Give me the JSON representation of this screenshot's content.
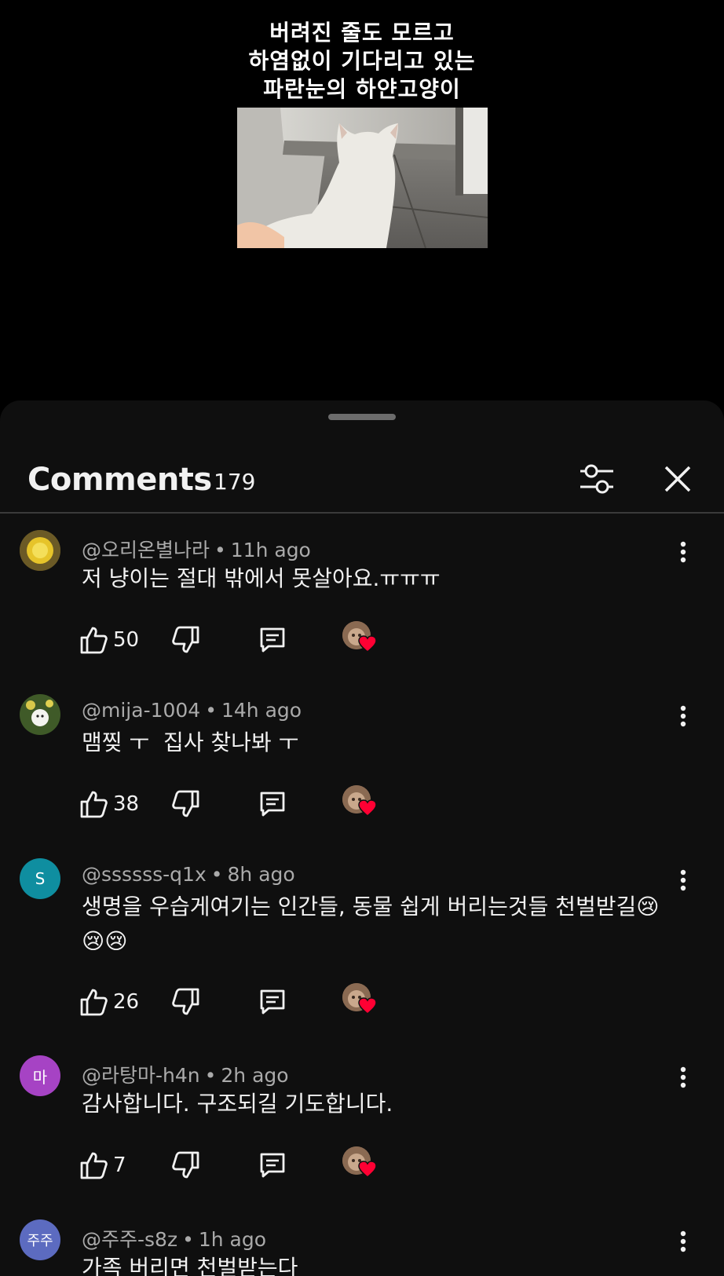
{
  "video": {
    "caption_lines": [
      "버려진 줄도 모르고",
      "하염없이 기다리고 있는",
      "파란눈의 하얀고양이"
    ]
  },
  "comments_panel": {
    "title": "Comments",
    "count": "179",
    "icons": {
      "filter": "sliders-icon",
      "close": "close-icon"
    }
  },
  "comments": [
    {
      "author": "@오리온별나라",
      "time": "11h ago",
      "text": "저 냥이는 절대 밖에서 못살아요.ㅠㅠㅠ",
      "likes": "50",
      "avatar_initial": "",
      "avatar_color": "#8a7a2a"
    },
    {
      "author": "@mija-1004",
      "time": "14h ago",
      "text": "맴찢 ㅜ  집사 찾나봐 ㅜ",
      "likes": "38",
      "avatar_initial": "",
      "avatar_color": "#3b5a2a"
    },
    {
      "author": "@ssssss-q1x",
      "time": "8h ago",
      "text": "생명을 우습게여기는 인간들, 동물 쉽게 버리는것들 천벌받길😢😢😢",
      "likes": "26",
      "avatar_initial": "S",
      "avatar_color": "#0f8ea0"
    },
    {
      "author": "@라탕마-h4n",
      "time": "2h ago",
      "text": "감사합니다. 구조되길 기도합니다.",
      "likes": "7",
      "avatar_initial": "마",
      "avatar_color": "#a643c4"
    },
    {
      "author": "@주주-s8z",
      "time": "1h ago",
      "text": "가족 버리면 천벌받는다",
      "likes": "",
      "avatar_initial": "주주",
      "avatar_color": "#5c6bc0"
    }
  ],
  "colors": {
    "sheet_bg": "#0f0f0f",
    "heart": "#ff0033",
    "meta_text": "#aaaaaa"
  }
}
